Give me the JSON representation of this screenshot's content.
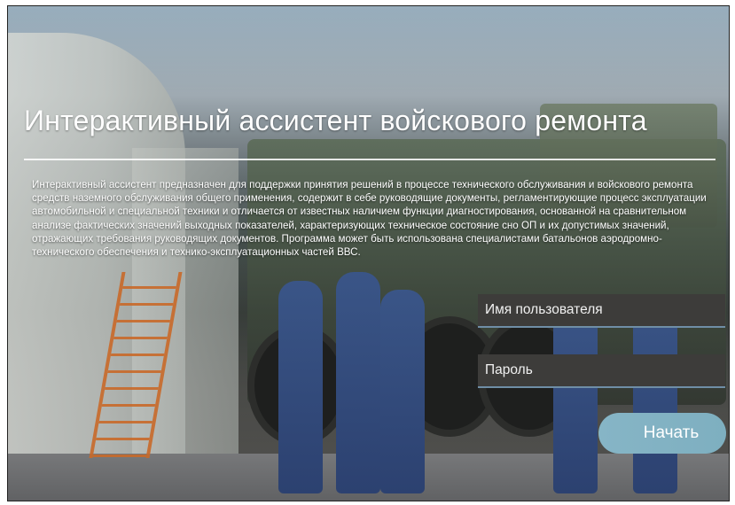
{
  "header": {
    "title": "Интерактивный ассистент войскового ремонта"
  },
  "description": {
    "text": "Интерактивный ассистент предназначен для поддержки принятия решений в процессе технического обслуживания и войскового ремонта средств наземного обслуживания общего применения, содержит в себе руководящие документы, регламентирующие процесс эксплуатации автомобильной и специальной техники и отличается от известных наличием функции диагностирования, основанной на сравнительном анализе фактических значений выходных показателей, характеризующих техническое состояние сно ОП и их допустимых значений, отражающих требования руководящих документов. Программа может быть использована специалистами батальонов аэродромно-технического обеспечения и технико-эксплуатационных частей ВВС."
  },
  "login": {
    "username_placeholder": "Имя пользователя",
    "username_value": "",
    "password_placeholder": "Пароль",
    "password_value": "",
    "start_label": "Начать"
  }
}
